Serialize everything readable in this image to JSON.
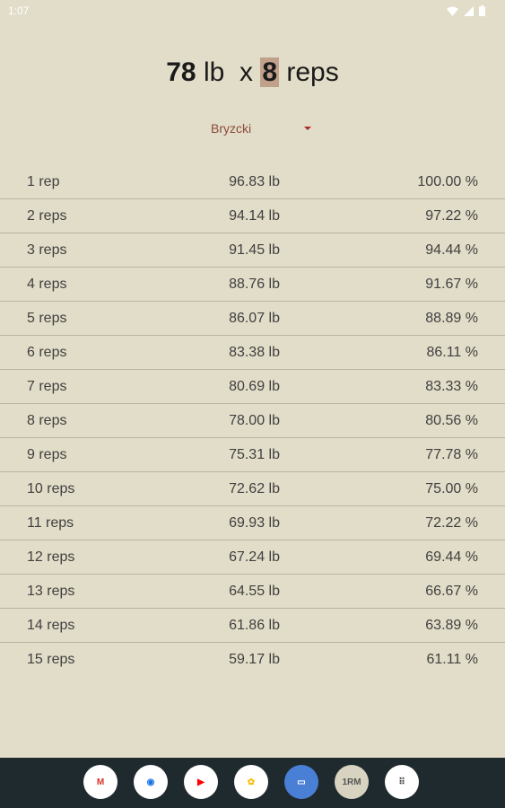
{
  "status": {
    "time": "1:07"
  },
  "headline": {
    "weight": "78",
    "weight_unit": "lb",
    "times": "x",
    "reps": "8",
    "reps_unit": "reps"
  },
  "formula": {
    "selected": "Bryzcki"
  },
  "table": {
    "rows": [
      {
        "reps": "1 rep",
        "weight": "96.83 lb",
        "percent": "100.00 %"
      },
      {
        "reps": "2 reps",
        "weight": "94.14 lb",
        "percent": "97.22 %"
      },
      {
        "reps": "3 reps",
        "weight": "91.45 lb",
        "percent": "94.44 %"
      },
      {
        "reps": "4 reps",
        "weight": "88.76 lb",
        "percent": "91.67 %"
      },
      {
        "reps": "5 reps",
        "weight": "86.07 lb",
        "percent": "88.89 %"
      },
      {
        "reps": "6 reps",
        "weight": "83.38 lb",
        "percent": "86.11 %"
      },
      {
        "reps": "7 reps",
        "weight": "80.69 lb",
        "percent": "83.33 %"
      },
      {
        "reps": "8 reps",
        "weight": "78.00 lb",
        "percent": "80.56 %"
      },
      {
        "reps": "9 reps",
        "weight": "75.31 lb",
        "percent": "77.78 %"
      },
      {
        "reps": "10 reps",
        "weight": "72.62 lb",
        "percent": "75.00 %"
      },
      {
        "reps": "11 reps",
        "weight": "69.93 lb",
        "percent": "72.22 %"
      },
      {
        "reps": "12 reps",
        "weight": "67.24 lb",
        "percent": "69.44 %"
      },
      {
        "reps": "13 reps",
        "weight": "64.55 lb",
        "percent": "66.67 %"
      },
      {
        "reps": "14 reps",
        "weight": "61.86 lb",
        "percent": "63.89 %"
      },
      {
        "reps": "15 reps",
        "weight": "59.17 lb",
        "percent": "61.11 %"
      }
    ]
  },
  "dock": {
    "apps": [
      {
        "name": "gmail-icon",
        "glyph": "M",
        "color": "#d93025"
      },
      {
        "name": "chrome-icon",
        "glyph": "◉",
        "color": "#1a73e8"
      },
      {
        "name": "youtube-icon",
        "glyph": "▶",
        "color": "#ff0000"
      },
      {
        "name": "photos-icon",
        "glyph": "✿",
        "color": "#fbbc04"
      },
      {
        "name": "messages-icon",
        "glyph": "▭",
        "color": "#1a73e8"
      },
      {
        "name": "onerm-app-icon",
        "glyph": "1RM",
        "color": "#555555"
      },
      {
        "name": "app-drawer-icon",
        "glyph": "⠿",
        "color": "#3c4043"
      }
    ]
  },
  "colors": {
    "background": "#e2ddc8",
    "highlight": "#c1a08c",
    "accent": "#a52a2a"
  }
}
